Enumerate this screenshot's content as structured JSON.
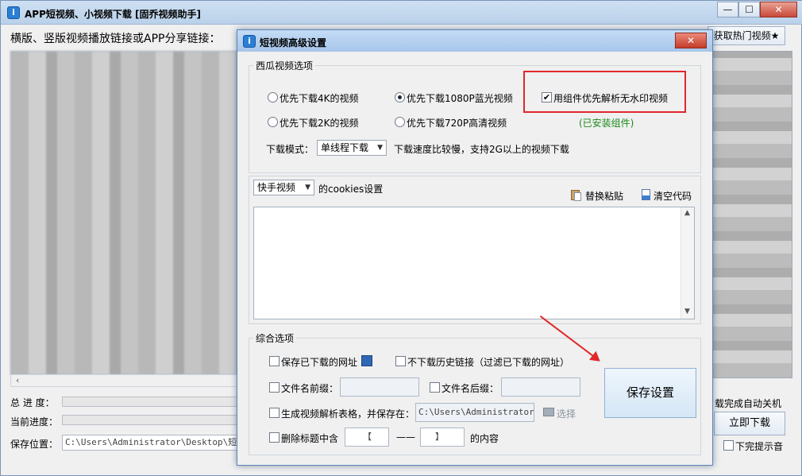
{
  "window": {
    "icon_glyph": "i",
    "title": "APP短视频、小视频下载 [固乔视频助手]",
    "minimize": "—",
    "maximize": "☐",
    "close": "✕"
  },
  "main": {
    "url_label": "横版、竖版视频播放链接或APP分享链接：",
    "hot_button": "获取热门视频★",
    "total_progress_label": "总 进 度：",
    "current_progress_label": "当前进度：",
    "save_location_label": "保存位置：",
    "save_location_value": "C:\\Users\\Administrator\\Desktop\\短视频",
    "auto_shutdown_label": "载完成自动关机",
    "download_now": "立即下载",
    "sound_label": "下完提示音"
  },
  "dialog": {
    "icon_glyph": "i",
    "title": "短视频高级设置",
    "close": "✕",
    "xigua": {
      "legend": "西瓜视频选项",
      "radio_4k": "优先下载4K的视频",
      "radio_1080p": "优先下载1080P蓝光视频",
      "radio_2k": "优先下载2K的视频",
      "radio_720p": "优先下载720P高清视频",
      "component_checkbox": "用组件优先解析无水印视频",
      "component_check_mark": "✔",
      "installed_text": "(已安装组件)",
      "mode_label": "下载模式：",
      "mode_value": "单线程下载",
      "mode_hint": "下载速度比较慢，支持2G以上的视频下载"
    },
    "cookies": {
      "platform": "快手视频",
      "label": "的cookies设置",
      "replace_paste": "替换粘贴",
      "clear_code": "清空代码"
    },
    "general": {
      "legend": "综合选项",
      "save_downloaded_urls": "保存已下载的网址",
      "skip_history": "不下载历史链接（过滤已下载的网址）",
      "prefix_label": "文件名前缀：",
      "suffix_label": "文件名后缀：",
      "gen_table_label": "生成视频解析表格，并保存在：",
      "gen_table_path": "C:\\Users\\Administrator\\De",
      "choose": "选择",
      "remove_label": "删除标题中含",
      "left_bracket": "【",
      "dash": "——",
      "right_bracket": "】",
      "content_label": "的内容"
    },
    "save_button": "保存设置"
  },
  "colors": {
    "accent_red": "#e0282c",
    "installed_green": "#1b8a1b"
  }
}
